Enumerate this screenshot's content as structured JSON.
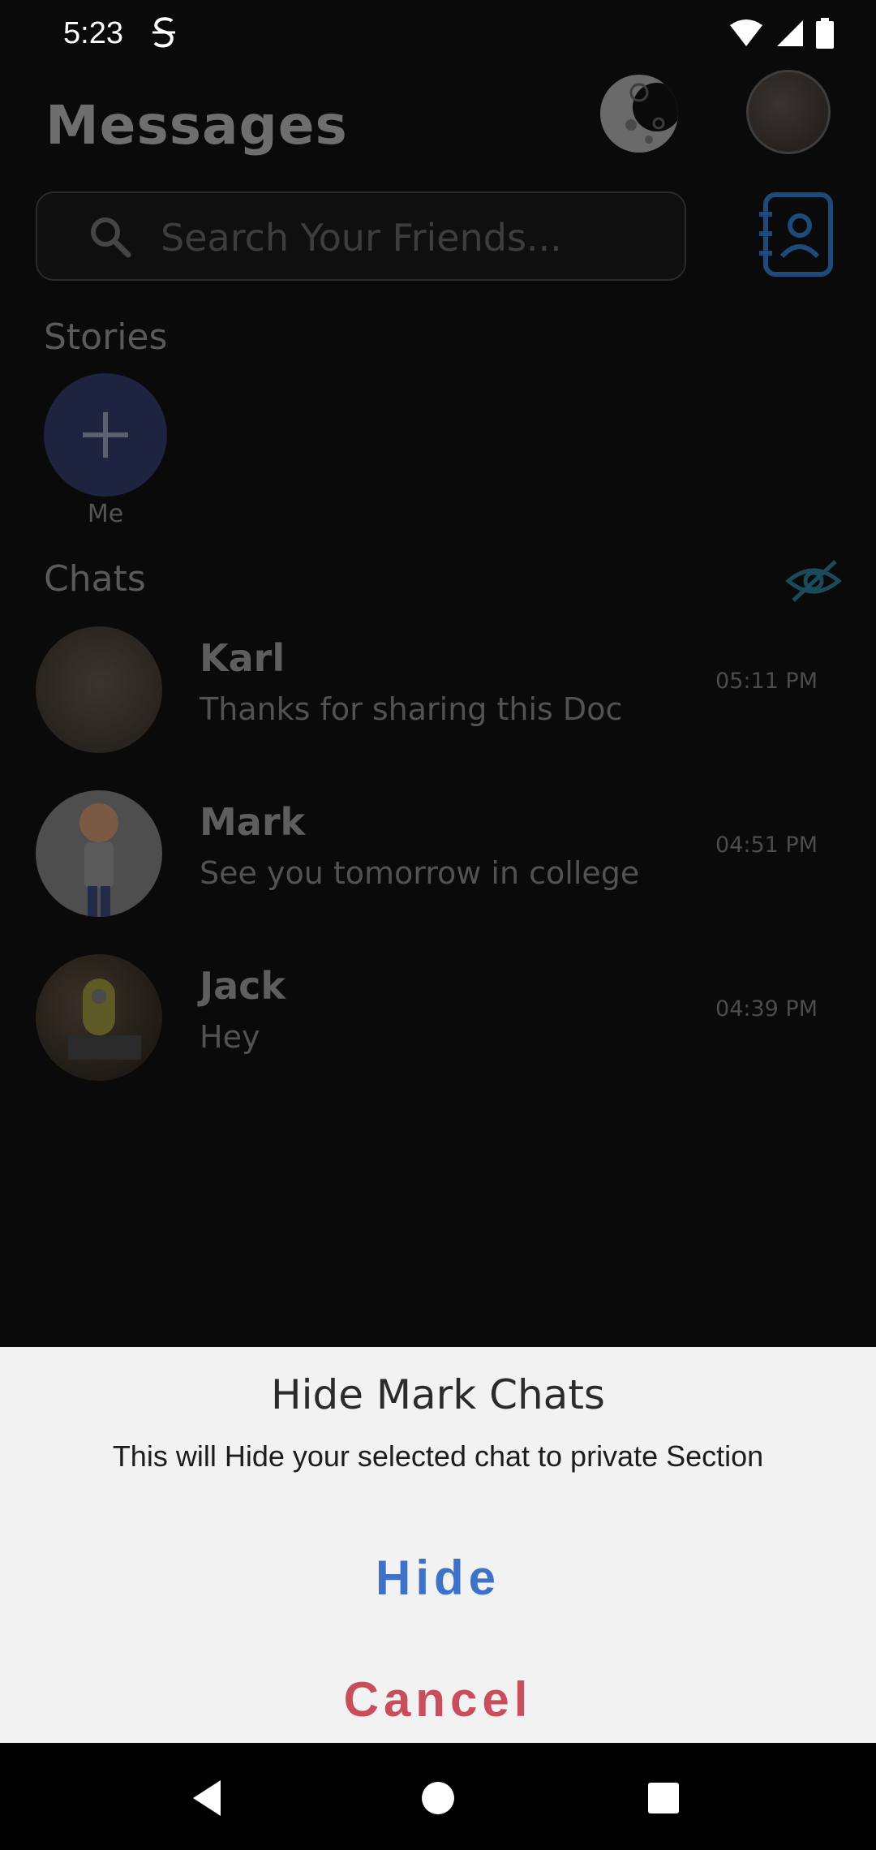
{
  "status_bar": {
    "time": "5:23"
  },
  "header": {
    "title": "Messages"
  },
  "search": {
    "placeholder": "Search Your Friends..."
  },
  "stories": {
    "label": "Stories",
    "me_label": "Me"
  },
  "chats": {
    "label": "Chats",
    "items": [
      {
        "name": "Karl",
        "message": "Thanks for sharing this Doc",
        "time": "05:11 PM"
      },
      {
        "name": "Mark",
        "message": "See you tomorrow in college",
        "time": "04:51 PM"
      },
      {
        "name": "Jack",
        "message": "Hey",
        "time": "04:39 PM"
      }
    ]
  },
  "dialog": {
    "title": "Hide Mark Chats",
    "message": "This will Hide your selected chat to private Section",
    "hide_label": "Hide",
    "cancel_label": "Cancel"
  },
  "colors": {
    "hide_accent": "#3e72c8",
    "cancel_accent": "#c84e5c",
    "contacts_accent": "#1d4a7a",
    "eye_accent": "#1b4a5a"
  }
}
